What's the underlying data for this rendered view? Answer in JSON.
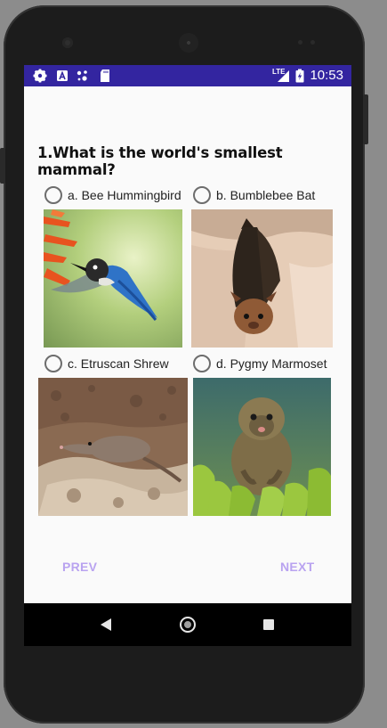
{
  "status_bar": {
    "time": "10:53",
    "network": "LTE",
    "icons": [
      "settings-gear-icon",
      "a-notification-icon",
      "dots-notification-icon",
      "sd-card-icon",
      "signal-icon",
      "battery-charging-icon"
    ]
  },
  "quiz": {
    "question": "1.What is the world's smallest mammal?",
    "options": [
      {
        "label": "a. Bee Hummingbird",
        "image": "hummingbird-photo"
      },
      {
        "label": "b. Bumblebee Bat",
        "image": "bat-photo"
      },
      {
        "label": "c. Etruscan Shrew",
        "image": "shrew-photo"
      },
      {
        "label": "d. Pygmy Marmoset",
        "image": "marmoset-photo"
      }
    ]
  },
  "buttons": {
    "prev": "PREV",
    "next": "NEXT"
  },
  "colors": {
    "status_bar": "#3325a0",
    "button_text": "#b9a3f0",
    "background": "#fafafa"
  }
}
